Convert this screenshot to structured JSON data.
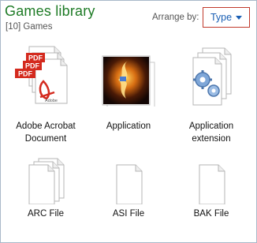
{
  "header": {
    "title": "Games library",
    "subtitle": "[10] Games",
    "arrange_label": "Arrange by:",
    "arrange_value": "Type"
  },
  "items": [
    {
      "label": "Adobe Acrobat",
      "label2": "Document",
      "icon": "pdf-document-stack-icon",
      "badge": "PDF",
      "badge2": "Adobe"
    },
    {
      "label": "Application",
      "icon": "application-icon"
    },
    {
      "label": "Application",
      "label2": "extension",
      "icon": "gears-document-stack-icon"
    },
    {
      "label": "ARC File",
      "icon": "blank-document-stack-icon"
    },
    {
      "label": "ASI File",
      "icon": "blank-document-icon"
    },
    {
      "label": "BAK File",
      "icon": "blank-document-icon"
    }
  ],
  "colors": {
    "title": "#1e7b26",
    "accent": "#1a5fb4",
    "highlight_border": "#c0392b",
    "pdf_red": "#d42a1e"
  }
}
